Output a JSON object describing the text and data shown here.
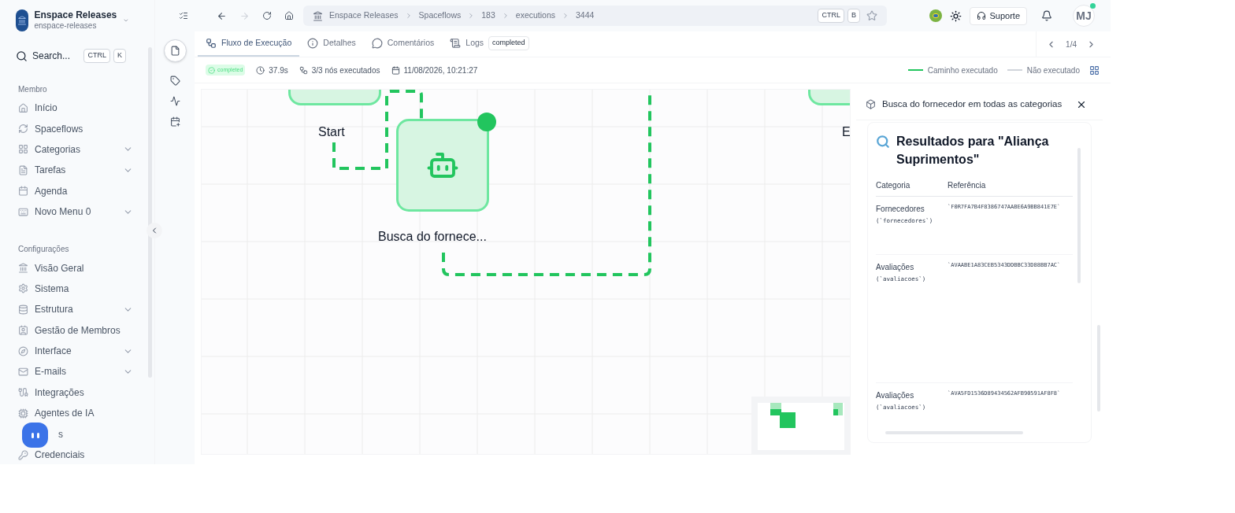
{
  "workspace": {
    "name": "Enspace Releases",
    "slug": "enspace-releases"
  },
  "search": {
    "placeholder": "Search...",
    "shortcut": [
      "CTRL",
      "K"
    ]
  },
  "sidebar": {
    "sections": [
      {
        "title": "Membro",
        "items": [
          {
            "label": "Início",
            "has_submenu": false
          },
          {
            "label": "Spaceflows",
            "has_submenu": false
          },
          {
            "label": "Categorias",
            "has_submenu": true
          },
          {
            "label": "Tarefas",
            "has_submenu": true
          },
          {
            "label": "Agenda",
            "has_submenu": false
          },
          {
            "label": "Novo Menu 0",
            "has_submenu": true
          }
        ]
      },
      {
        "title": "Configurações",
        "items": [
          {
            "label": "Visão Geral",
            "has_submenu": false
          },
          {
            "label": "Sistema",
            "has_submenu": false
          },
          {
            "label": "Estrutura",
            "has_submenu": true
          },
          {
            "label": "Gestão de Membros",
            "has_submenu": false
          },
          {
            "label": "Interface",
            "has_submenu": true
          },
          {
            "label": "E-mails",
            "has_submenu": true
          },
          {
            "label": "Integrações",
            "has_submenu": false
          },
          {
            "label": "Agentes de IA",
            "has_submenu": false
          },
          {
            "label": "s",
            "has_submenu": false
          },
          {
            "label": "Credenciais",
            "has_submenu": false
          }
        ]
      }
    ]
  },
  "breadcrumb": [
    "Enspace Releases",
    "Spaceflows",
    "183",
    "executions",
    "3444"
  ],
  "breadcrumb_shortcut": [
    "CTRL",
    "B"
  ],
  "support_button": "Suporte",
  "avatar": "MJ",
  "tabs": [
    {
      "label": "Fluxo de Execução",
      "selected": true
    },
    {
      "label": "Detalhes",
      "selected": false
    },
    {
      "label": "Comentários",
      "selected": false
    },
    {
      "label": "Logs",
      "selected": false,
      "badge": "completed"
    }
  ],
  "pager": "1/4",
  "run_info": {
    "status": "completed",
    "duration": "37.9s",
    "nodes": "3/3 nós executados",
    "date": "11/08/2026, 10:21:27"
  },
  "legend": [
    {
      "label": "Caminho executado",
      "color": "#22c55e"
    },
    {
      "label": "Não executado",
      "color": "#d1d5db"
    }
  ],
  "canvas": {
    "nodes": [
      {
        "label": "Start"
      },
      {
        "label": "Busca do fornece..."
      },
      {
        "label": "E"
      }
    ]
  },
  "detail_panel": {
    "title": "Busca do fornecedor em todas as categorias",
    "heading": "Resultados para \"Aliança Suprimentos\"",
    "columns": [
      "Categoria",
      "Referência"
    ],
    "rows": [
      {
        "category": "Fornecedores",
        "table": "(`fornecedores`)",
        "reference": "`F0R7FA7B4F8386747AABE6A9BB841E7E`"
      },
      {
        "category": "Avaliações",
        "table": "(`avaliacoes`)",
        "reference": "`AVAABE1A83CEB5343DDBBC33D88BB7AC`"
      },
      {
        "category": "Avaliações",
        "table": "(`avaliacoes`)",
        "reference": "`AVA5FD1536D89434562AFB90591AF8F8`"
      }
    ]
  }
}
